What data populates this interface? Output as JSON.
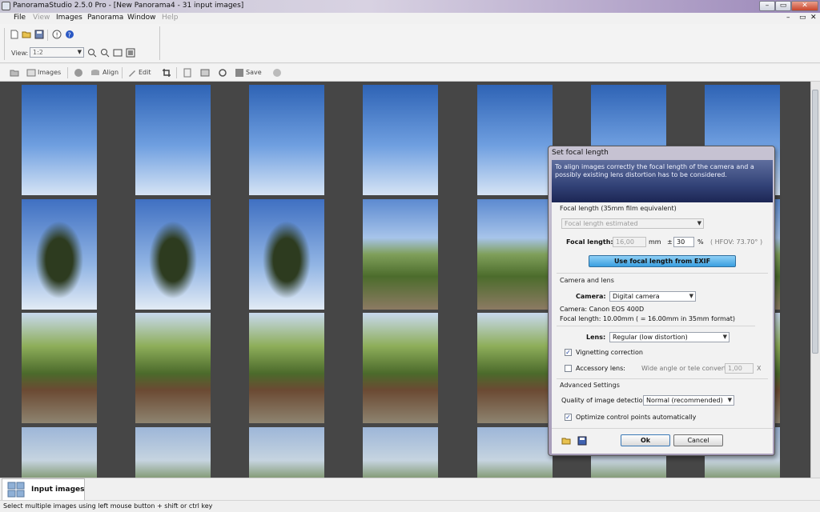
{
  "window": {
    "title": "PanoramaStudio 2.5.0 Pro - [New Panorama4 - 31 input images]"
  },
  "menu": [
    "File",
    "View",
    "Images",
    "Panorama",
    "Window",
    "Help"
  ],
  "toolbar": {
    "view_label": "View:",
    "zoom_value": "1:2",
    "images_label": "Images",
    "align_label": "Align",
    "edit_label": "Edit",
    "save_label": "Save"
  },
  "dialog": {
    "title": "Set focal length",
    "intro": "To align images correctly the focal length of the camera and a possibly existing lens distortion has to be considered.",
    "focal_group": "Focal length (35mm film equivalent)",
    "focal_mode": "Focal length estimated",
    "focal_label": "Focal length:",
    "focal_value": "16,00",
    "focal_unit": "mm",
    "tolerance_sign": "±",
    "tolerance_value": "30",
    "tolerance_unit": "%",
    "hfov": "( HFOV: 73.70° )",
    "exif_button": "Use focal length from EXIF",
    "camera_group": "Camera and lens",
    "camera_label": "Camera:",
    "camera_value": "Digital camera",
    "camera_info": "Camera: Canon EOS 400D",
    "focal_info": "Focal length: 10.00mm ( = 16.00mm in 35mm format)",
    "lens_label": "Lens:",
    "lens_value": "Regular  (low distortion)",
    "vignetting_label": "Vignetting correction",
    "vignetting_checked": true,
    "accessory_label": "Accessory lens:",
    "accessory_checked": false,
    "converter_label": "Wide angle or tele converter",
    "converter_value": "1,00",
    "converter_x": "X",
    "advanced_group": "Advanced Settings",
    "quality_label": "Quality of image detection:",
    "quality_value": "Normal (recommended)",
    "optimize_label": "Optimize control points automatically",
    "optimize_checked": true,
    "ok_label": "Ok",
    "cancel_label": "Cancel",
    "check_mark": "✓"
  },
  "bottom_tab": "Input images",
  "status": "Select multiple images using left mouse button + shift or ctrl key",
  "winbuttons": {
    "minimize": "–",
    "restore": "▭",
    "close": "✕",
    "min2": "–",
    "restore2": "▭",
    "close2": "✕"
  }
}
